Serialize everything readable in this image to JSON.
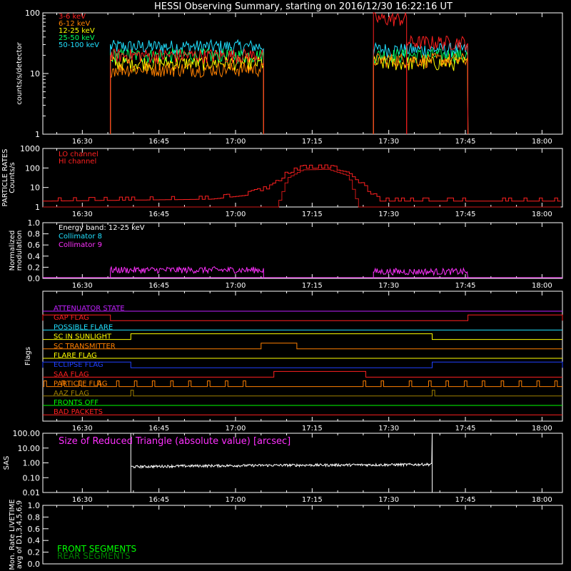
{
  "title": "HESSI Observing Summary, starting on 2016/12/30 16:22:16 UT",
  "time_ticks": [
    "16:30",
    "16:45",
    "17:00",
    "17:15",
    "17:30",
    "17:45",
    "18:00"
  ],
  "time_tick_minutes": [
    30,
    45,
    60,
    75,
    90,
    105,
    120
  ],
  "time_range_minutes": [
    22.27,
    124
  ],
  "panels": {
    "rates": {
      "ylabel": "counts/s/detector",
      "yticks": [
        "1",
        "10",
        "100"
      ],
      "legend": [
        {
          "label": "3-6 keV",
          "color": "#ff2020"
        },
        {
          "label": "6-12 keV",
          "color": "#ff8000"
        },
        {
          "label": "12-25 keV",
          "color": "#ffff00"
        },
        {
          "label": "25-50 keV",
          "color": "#00ff60"
        },
        {
          "label": "50-100 keV",
          "color": "#20e0ff"
        }
      ]
    },
    "particle": {
      "ylabel1": "PARTICLE RATES",
      "ylabel2": "Counts/s",
      "yticks": [
        "1",
        "10",
        "100",
        "1000"
      ],
      "legend": [
        {
          "label": "LO channel",
          "color": "#ff2020"
        },
        {
          "label": "HI channel",
          "color": "#ff2020"
        }
      ]
    },
    "modulation": {
      "ylabel1": "Normalized",
      "ylabel2": "modulation",
      "yticks": [
        "0.0",
        "0.2",
        "0.4",
        "0.6",
        "0.8",
        "1.0"
      ],
      "legend": [
        {
          "label": "Energy band: 12-25 keV",
          "color": "#ffffff"
        },
        {
          "label": "Collimator 8",
          "color": "#20e0ff"
        },
        {
          "label": "Collimator 9",
          "color": "#ff30ff"
        }
      ]
    },
    "flags": {
      "ylabel": "Flags",
      "items": [
        {
          "label": "ATTENUATOR STATE",
          "color": "#c020ff"
        },
        {
          "label": "GAP FLAG",
          "color": "#ff2020"
        },
        {
          "label": "POSSIBLE FLARE",
          "color": "#20e0ff"
        },
        {
          "label": "SC IN SUNLIGHT",
          "color": "#ffff00"
        },
        {
          "label": "SC TRANSMITTER",
          "color": "#ff8000"
        },
        {
          "label": "FLARE FLAG",
          "color": "#ffff00"
        },
        {
          "label": "ECLIPSE FLAG",
          "color": "#2040ff"
        },
        {
          "label": "SAA FLAG",
          "color": "#ff2020"
        },
        {
          "label": "PARTICLE FLAG",
          "color": "#ff8000"
        },
        {
          "label": "AAZ FLAG",
          "color": "#a08000"
        },
        {
          "label": "FRONTS OFF",
          "color": "#00ff00"
        },
        {
          "label": "BAD PACKETS",
          "color": "#ff2020"
        }
      ]
    },
    "sas": {
      "ylabel": "SAS",
      "yticks": [
        "0.01",
        "0.10",
        "1.00",
        "10.00",
        "100.00"
      ],
      "legend": "Size of Reduced Triangle (absolute value) [arcsec]",
      "legend_color": "#ff30ff"
    },
    "livetime": {
      "ylabel1": "Mon. Rate LIVETIME",
      "ylabel2": "avg of D1,3,4,5,6,9",
      "yticks": [
        "0.0",
        "0.2",
        "0.4",
        "0.6",
        "0.8",
        "1.0"
      ],
      "legend": [
        {
          "label": "FRONT SEGMENTS",
          "color": "#00ff00"
        },
        {
          "label": "REAR SEGMENTS",
          "color": "#008000"
        }
      ]
    }
  },
  "chart_data": {
    "type": "line",
    "x_unit": "minutes after 16:00 UT",
    "rates": {
      "yscale": "log",
      "ylim": [
        1,
        100
      ],
      "intervals": [
        [
          35.5,
          65.5
        ],
        [
          87.0,
          105.5
        ]
      ],
      "series": [
        {
          "name": "3-6 keV",
          "levels": [
            [
              35.5,
              65.5,
              20
            ],
            [
              87.0,
              93.5,
              80
            ],
            [
              93.5,
              105.5,
              33
            ]
          ]
        },
        {
          "name": "6-12 keV",
          "levels": [
            [
              35.5,
              65.5,
              12
            ],
            [
              87.0,
              105.5,
              17
            ]
          ]
        },
        {
          "name": "12-25 keV",
          "levels": [
            [
              35.5,
              65.5,
              15
            ],
            [
              87.0,
              105.5,
              15
            ]
          ]
        },
        {
          "name": "25-50 keV",
          "levels": [
            [
              35.5,
              65.5,
              20
            ],
            [
              87.0,
              105.5,
              20
            ]
          ]
        },
        {
          "name": "50-100 keV",
          "levels": [
            [
              35.5,
              65.5,
              28
            ],
            [
              87.0,
              105.5,
              25
            ]
          ]
        }
      ]
    },
    "particle": {
      "yscale": "log",
      "ylim": [
        1,
        1000
      ],
      "lo_channel_profile": [
        [
          22.27,
          2
        ],
        [
          55,
          2.5
        ],
        [
          62,
          4
        ],
        [
          67,
          10
        ],
        [
          70,
          50
        ],
        [
          73,
          95
        ],
        [
          78,
          100
        ],
        [
          82,
          60
        ],
        [
          85,
          10
        ],
        [
          88,
          2
        ],
        [
          124,
          2
        ]
      ],
      "hi_channel_profile": [
        [
          22.27,
          1
        ],
        [
          68,
          1
        ],
        [
          70,
          30
        ],
        [
          73,
          80
        ],
        [
          78,
          85
        ],
        [
          82,
          40
        ],
        [
          84,
          1
        ],
        [
          124,
          1
        ]
      ]
    },
    "modulation": {
      "ylim": [
        0,
        1
      ],
      "series": [
        {
          "name": "Collimator 9",
          "levels": [
            [
              35.5,
              65.5,
              0.15
            ],
            [
              87.0,
              105.5,
              0.12
            ]
          ]
        }
      ]
    },
    "flags": [
      {
        "name": "ATTENUATOR STATE",
        "segments": []
      },
      {
        "name": "GAP FLAG",
        "segments": [
          [
            22.27,
            35.5
          ],
          [
            105.5,
            124
          ]
        ]
      },
      {
        "name": "POSSIBLE FLARE",
        "segments": []
      },
      {
        "name": "SC IN SUNLIGHT",
        "segments": [
          [
            39.5,
            98.5
          ]
        ]
      },
      {
        "name": "SC TRANSMITTER",
        "segments": [
          [
            65.0,
            72.0
          ]
        ]
      },
      {
        "name": "FLARE FLAG",
        "segments": []
      },
      {
        "name": "ECLIPSE FLAG",
        "segments": [
          [
            22.27,
            39.5
          ],
          [
            98.5,
            124
          ]
        ]
      },
      {
        "name": "SAA FLAG",
        "segments": [
          [
            67.5,
            85.5
          ]
        ]
      },
      {
        "name": "PARTICLE FLAG",
        "segments": [
          [
            22.5,
            23
          ],
          [
            26,
            26.5
          ],
          [
            29.3,
            29.8
          ],
          [
            33,
            33.5
          ],
          [
            36.7,
            37.2
          ],
          [
            40.2,
            40.7
          ],
          [
            43.7,
            44.2
          ],
          [
            47.3,
            47.8
          ],
          [
            50.8,
            51.3
          ],
          [
            54.5,
            55
          ],
          [
            58,
            58.5
          ],
          [
            61.5,
            62
          ],
          [
            85,
            85.5
          ],
          [
            88.5,
            89
          ],
          [
            94,
            94.5
          ],
          [
            97.8,
            98.3
          ],
          [
            101.2,
            101.7
          ],
          [
            104.8,
            105.3
          ],
          [
            108.3,
            108.8
          ],
          [
            112,
            112.5
          ],
          [
            115.5,
            116
          ],
          [
            119,
            119.5
          ],
          [
            122.5,
            123
          ]
        ]
      },
      {
        "name": "AAZ FLAG",
        "segments": [
          [
            39.5,
            40
          ],
          [
            98.5,
            99
          ]
        ]
      },
      {
        "name": "FRONTS OFF",
        "segments": []
      },
      {
        "name": "BAD PACKETS",
        "segments": []
      }
    ],
    "sas": {
      "yscale": "log",
      "ylim": [
        0.01,
        100
      ],
      "series": [
        {
          "name": "Size of Reduced Triangle (absolute value) [arcsec]",
          "profile": [
            [
              39.5,
              0.55
            ],
            [
              50,
              0.62
            ],
            [
              70,
              0.7
            ],
            [
              90,
              0.75
            ],
            [
              98.5,
              0.8
            ]
          ]
        }
      ]
    },
    "livetime": {
      "ylim": [
        0,
        1
      ],
      "series": []
    }
  }
}
